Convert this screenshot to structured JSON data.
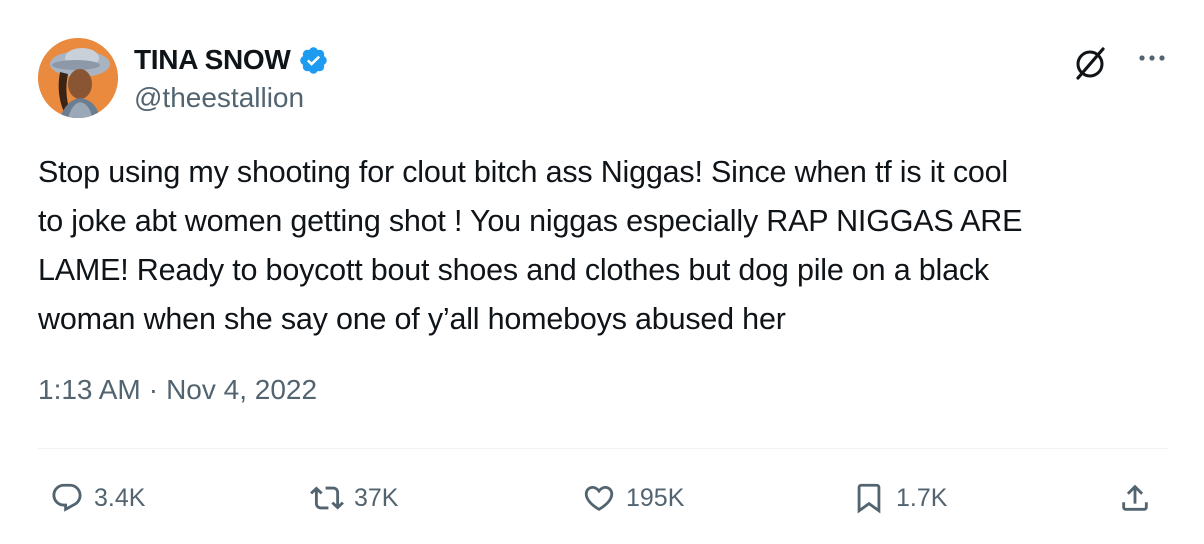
{
  "author": {
    "display_name": "TINA SNOW",
    "handle": "@theestallion",
    "verified": true,
    "verified_color": "#1d9bf0"
  },
  "tweet": {
    "text_lines": [
      "Stop using my shooting for clout bitch ass Niggas! Since when tf is it cool",
      "to joke abt women getting shot ! You niggas especially RAP NIGGAS ARE",
      "LAME! Ready to boycott bout shoes and clothes but dog pile on a black",
      "woman when she say one of y’all homeboys abused her"
    ],
    "time": "1:13 AM",
    "separator": "·",
    "date": "Nov 4, 2022"
  },
  "actions": {
    "replies": "3.4K",
    "reposts": "37K",
    "likes": "195K",
    "bookmarks": "1.7K"
  },
  "icons": {
    "header": [
      "grok-icon",
      "more-icon"
    ],
    "actions": [
      "reply-icon",
      "repost-icon",
      "like-icon",
      "bookmark-icon",
      "share-icon"
    ]
  },
  "colors": {
    "text_primary": "#0f1419",
    "text_secondary": "#536471",
    "divider": "#eff3f4"
  }
}
